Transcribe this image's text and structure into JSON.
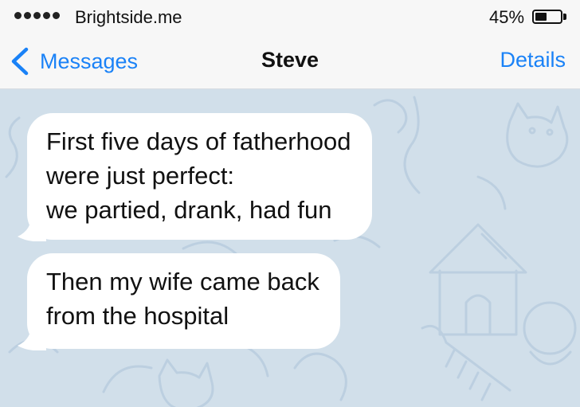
{
  "status_bar": {
    "carrier": "Brightside.me",
    "battery_percent": "45%",
    "battery_level": 0.45
  },
  "nav": {
    "back_label": "Messages",
    "title": "Steve",
    "details_label": "Details"
  },
  "colors": {
    "accent": "#1a82f7",
    "chat_background": "#d1dfea",
    "bubble": "#ffffff"
  },
  "messages": [
    {
      "lines": [
        "First five days of fatherhood",
        "were just perfect:",
        "we partied, drank, had fun"
      ]
    },
    {
      "lines": [
        "Then my wife came back",
        "from the hospital"
      ]
    }
  ]
}
